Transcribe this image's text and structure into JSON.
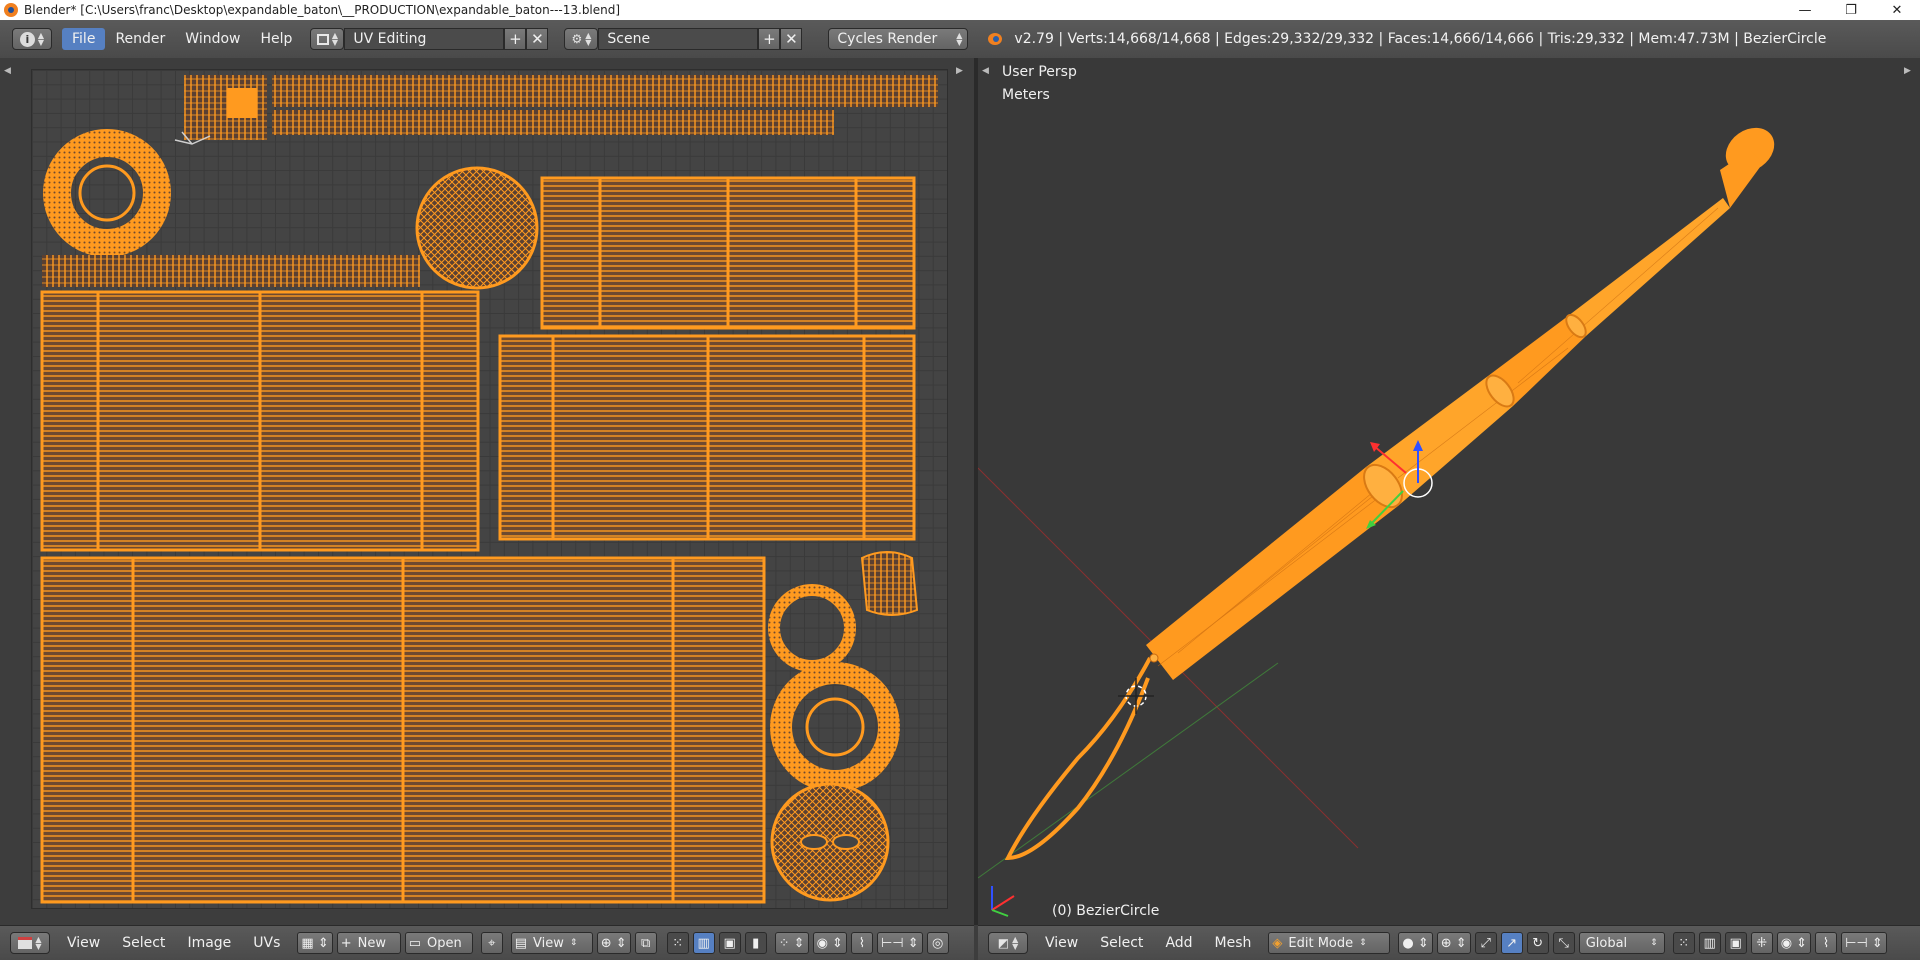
{
  "window": {
    "title": "Blender* [C:\\Users\\franc\\Desktop\\expandable_baton\\__PRODUCTION\\expandable_baton---13.blend]",
    "minimize": "—",
    "maximize": "❐",
    "close": "✕"
  },
  "info_header": {
    "menus": [
      "File",
      "Render",
      "Window",
      "Help"
    ],
    "active_menu": "File",
    "screen_layout": "UV Editing",
    "scene": "Scene",
    "render_engine": "Cycles Render",
    "stats": "v2.79 | Verts:14,668/14,668 | Edges:29,332/29,332 | Faces:14,666/14,666 | Tris:29,332 | Mem:47.73M | BezierCircle"
  },
  "uv_editor": {
    "header": {
      "menus": [
        "View",
        "Select",
        "Image",
        "UVs"
      ],
      "new_label": "New",
      "open_label": "Open",
      "view_label": "View"
    }
  },
  "viewport": {
    "view_name": "User Persp",
    "units": "Meters",
    "object_label": "(0) BezierCircle",
    "header": {
      "menus": [
        "View",
        "Select",
        "Add",
        "Mesh"
      ],
      "mode": "Edit Mode",
      "orientation": "Global"
    }
  },
  "colors": {
    "wire": "#ff9a1f",
    "uv_face_fill": "#6e4a30",
    "ui_header": "#4f4f4f",
    "active_blue": "#5680c2"
  },
  "icons": {
    "info_editor": "info-icon",
    "screen_layout": "layout-icon",
    "scene": "scene-icon",
    "render_engine": "render-engine-dropdown",
    "blender_logo": "blender-logo-icon"
  }
}
